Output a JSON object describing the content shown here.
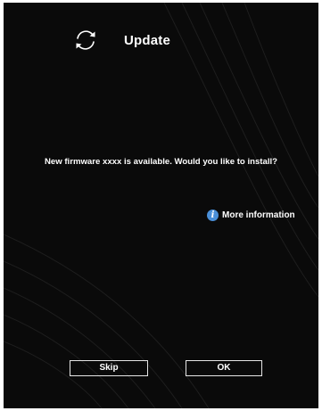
{
  "header": {
    "title": "Update",
    "icon": "refresh-icon"
  },
  "message": "New firmware xxxx is available. Would you like to install?",
  "more_info": {
    "label": "More information",
    "icon": "info-icon",
    "icon_glyph": "i",
    "icon_color": "#4a8fd8"
  },
  "buttons": {
    "skip_label": "Skip",
    "ok_label": "OK"
  },
  "colors": {
    "background": "#0a0a0a",
    "text": "#ffffff",
    "button_border": "#e6e6e6"
  }
}
